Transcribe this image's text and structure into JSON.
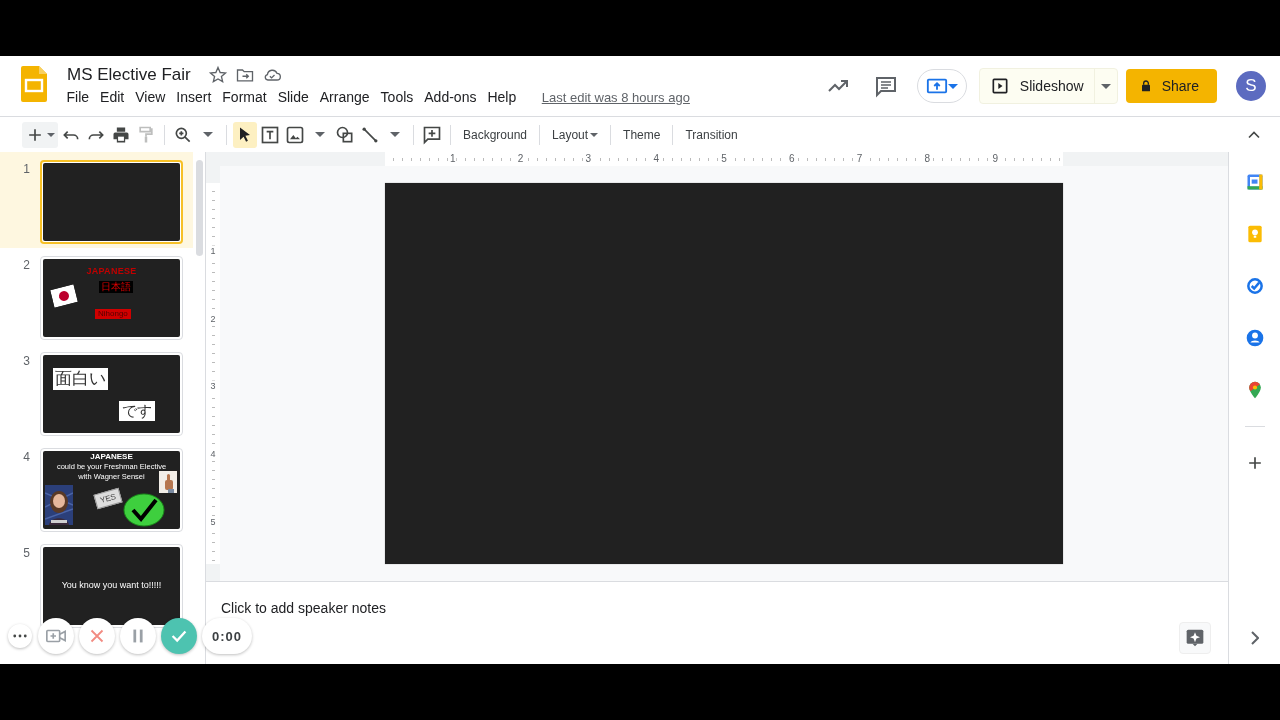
{
  "app": {
    "title": "MS Elective Fair",
    "menu": [
      "File",
      "Edit",
      "View",
      "Insert",
      "Format",
      "Slide",
      "Arrange",
      "Tools",
      "Add-ons",
      "Help"
    ],
    "last_edit": "Last edit was 8 hours ago",
    "slideshow": "Slideshow",
    "share": "Share",
    "avatar": "S"
  },
  "toolbar": {
    "paint_format": {
      "disabled": true
    },
    "tools": [
      {
        "selected": true
      },
      {
        "selected": false
      },
      {
        "selected": false
      },
      {
        "selected": false
      },
      {
        "selected": false
      }
    ],
    "text_buttons": [
      {
        "label": "Background",
        "dropdown": false
      },
      {
        "label": "Layout",
        "dropdown": true
      },
      {
        "label": "Theme",
        "dropdown": false
      },
      {
        "label": "Transition",
        "dropdown": false
      }
    ]
  },
  "filmstrip": {
    "slides": [
      {
        "number": "1",
        "selected": true,
        "kind": "blank"
      },
      {
        "number": "2",
        "selected": false,
        "kind": "flag",
        "title": "JAPANESE",
        "subtitle": "日本語",
        "caption": "Nihongo"
      },
      {
        "number": "3",
        "selected": false,
        "kind": "words",
        "texts": [
          "面白い",
          "です"
        ]
      },
      {
        "number": "4",
        "selected": false,
        "kind": "promo",
        "title": "JAPANESE",
        "lines": [
          "could be your Freshman Elective",
          "with Wagner Sensei"
        ],
        "card": "YES"
      },
      {
        "number": "5",
        "selected": false,
        "kind": "statement",
        "text": "You know you want to!!!!!"
      }
    ]
  },
  "editor": {
    "ruler_h": [
      "1",
      "2",
      "3",
      "4",
      "5",
      "6",
      "7",
      "8",
      "9"
    ],
    "ruler_v": [
      "1",
      "2",
      "3",
      "4",
      "5"
    ],
    "speaker_notes": {
      "placeholder": "Click to add speaker notes"
    }
  },
  "recorder": {
    "timer": "0:00"
  }
}
